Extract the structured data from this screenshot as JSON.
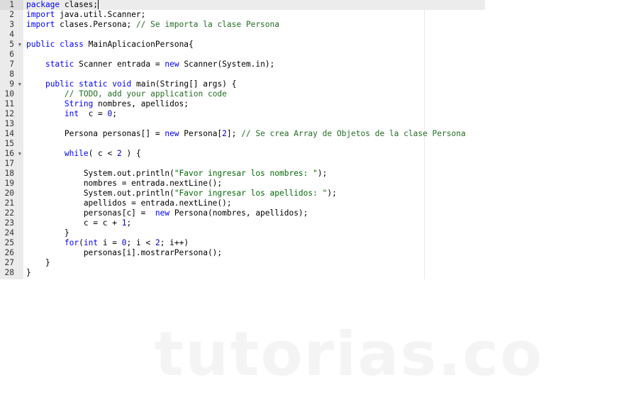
{
  "editor": {
    "language": "java",
    "active_line": 1,
    "lines": [
      {
        "n": "1",
        "fold": false,
        "tokens": [
          [
            "kw",
            "package"
          ],
          [
            "plain",
            " clases;"
          ]
        ]
      },
      {
        "n": "2",
        "fold": false,
        "tokens": [
          [
            "kw",
            "import"
          ],
          [
            "plain",
            " java.util.Scanner;"
          ]
        ]
      },
      {
        "n": "3",
        "fold": false,
        "tokens": [
          [
            "kw",
            "import"
          ],
          [
            "plain",
            " clases.Persona; "
          ],
          [
            "cm",
            "// Se importa la clase Persona"
          ]
        ]
      },
      {
        "n": "4",
        "fold": false,
        "tokens": []
      },
      {
        "n": "5",
        "fold": true,
        "tokens": [
          [
            "kw",
            "public"
          ],
          [
            "plain",
            " "
          ],
          [
            "kw",
            "class"
          ],
          [
            "plain",
            " MainAplicacionPersona{"
          ]
        ]
      },
      {
        "n": "6",
        "fold": false,
        "tokens": []
      },
      {
        "n": "7",
        "fold": false,
        "tokens": [
          [
            "plain",
            "    "
          ],
          [
            "kw",
            "static"
          ],
          [
            "plain",
            " Scanner entrada = "
          ],
          [
            "kw",
            "new"
          ],
          [
            "plain",
            " Scanner(System.in);"
          ]
        ]
      },
      {
        "n": "8",
        "fold": false,
        "tokens": []
      },
      {
        "n": "9",
        "fold": true,
        "tokens": [
          [
            "plain",
            "    "
          ],
          [
            "kw",
            "public"
          ],
          [
            "plain",
            " "
          ],
          [
            "kw",
            "static"
          ],
          [
            "plain",
            " "
          ],
          [
            "kw",
            "void"
          ],
          [
            "plain",
            " main(String[] args) {"
          ]
        ]
      },
      {
        "n": "10",
        "fold": false,
        "tokens": [
          [
            "plain",
            "        "
          ],
          [
            "cm",
            "// TODO, add your application code"
          ]
        ]
      },
      {
        "n": "11",
        "fold": false,
        "tokens": [
          [
            "plain",
            "        "
          ],
          [
            "kw",
            "String"
          ],
          [
            "plain",
            " nombres, apellidos;"
          ]
        ]
      },
      {
        "n": "12",
        "fold": false,
        "tokens": [
          [
            "plain",
            "        "
          ],
          [
            "kw",
            "int"
          ],
          [
            "plain",
            "  c = "
          ],
          [
            "num-lit",
            "0"
          ],
          [
            "plain",
            ";"
          ]
        ]
      },
      {
        "n": "13",
        "fold": false,
        "tokens": []
      },
      {
        "n": "14",
        "fold": false,
        "tokens": [
          [
            "plain",
            "        Persona personas[] = "
          ],
          [
            "kw",
            "new"
          ],
          [
            "plain",
            " Persona["
          ],
          [
            "num-lit",
            "2"
          ],
          [
            "plain",
            "]; "
          ],
          [
            "cm",
            "// Se crea Array de Objetos de la clase Persona"
          ]
        ]
      },
      {
        "n": "15",
        "fold": false,
        "tokens": []
      },
      {
        "n": "16",
        "fold": true,
        "tokens": [
          [
            "plain",
            "        "
          ],
          [
            "kw",
            "while"
          ],
          [
            "plain",
            "( c < "
          ],
          [
            "num-lit",
            "2"
          ],
          [
            "plain",
            " ) {"
          ]
        ]
      },
      {
        "n": "17",
        "fold": false,
        "tokens": []
      },
      {
        "n": "18",
        "fold": false,
        "tokens": [
          [
            "plain",
            "            System.out.println("
          ],
          [
            "str",
            "\"Favor ingresar los nombres: \""
          ],
          [
            "plain",
            ");"
          ]
        ]
      },
      {
        "n": "19",
        "fold": false,
        "tokens": [
          [
            "plain",
            "            nombres = entrada.nextLine();"
          ]
        ]
      },
      {
        "n": "20",
        "fold": false,
        "tokens": [
          [
            "plain",
            "            System.out.println("
          ],
          [
            "str",
            "\"Favor ingresar los apellidos: \""
          ],
          [
            "plain",
            ");"
          ]
        ]
      },
      {
        "n": "21",
        "fold": false,
        "tokens": [
          [
            "plain",
            "            apellidos = entrada.nextLine();"
          ]
        ]
      },
      {
        "n": "22",
        "fold": false,
        "tokens": [
          [
            "plain",
            "            personas[c] =  "
          ],
          [
            "kw",
            "new"
          ],
          [
            "plain",
            " Persona(nombres, apellidos);"
          ]
        ]
      },
      {
        "n": "23",
        "fold": false,
        "tokens": [
          [
            "plain",
            "            c = c + "
          ],
          [
            "num-lit",
            "1"
          ],
          [
            "plain",
            ";"
          ]
        ]
      },
      {
        "n": "24",
        "fold": false,
        "tokens": [
          [
            "plain",
            "        }"
          ]
        ]
      },
      {
        "n": "25",
        "fold": false,
        "tokens": [
          [
            "plain",
            "        "
          ],
          [
            "kw",
            "for"
          ],
          [
            "plain",
            "("
          ],
          [
            "kw",
            "int"
          ],
          [
            "plain",
            " i = "
          ],
          [
            "num-lit",
            "0"
          ],
          [
            "plain",
            "; i < "
          ],
          [
            "num-lit",
            "2"
          ],
          [
            "plain",
            "; i++)"
          ]
        ]
      },
      {
        "n": "26",
        "fold": false,
        "tokens": [
          [
            "plain",
            "            personas[i].mostrarPersona();"
          ]
        ]
      },
      {
        "n": "27",
        "fold": false,
        "tokens": [
          [
            "plain",
            "    }"
          ]
        ]
      },
      {
        "n": "28",
        "fold": false,
        "tokens": [
          [
            "plain",
            "}"
          ]
        ]
      }
    ]
  },
  "fold_icon": "chevron-down-icon",
  "watermark": "tutorias.co"
}
